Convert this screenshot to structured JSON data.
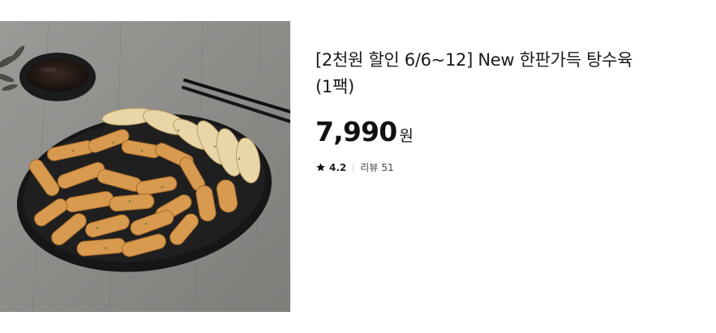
{
  "product": {
    "image_alt": "탕수육 상품 이미지",
    "title_line1": "[2천원 할인 6/6~12] New 한판가득 탕수육",
    "title_line2": "(1팩)",
    "price": "7,990",
    "currency": "원",
    "rating": "4.2",
    "review_label": "리뷰",
    "review_count": "51"
  },
  "icons": {
    "rating": "star-icon"
  },
  "colors": {
    "text": "#111111",
    "muted": "#444444",
    "divider": "#cfcfcf"
  }
}
